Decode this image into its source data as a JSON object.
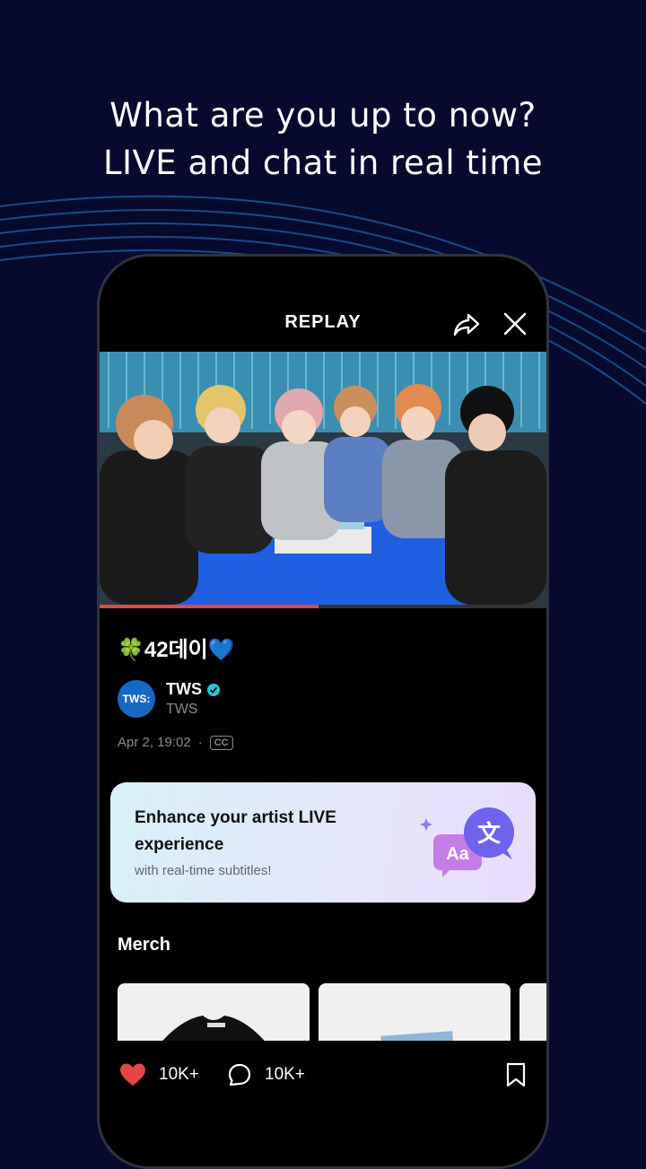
{
  "headline": {
    "line1": "What are you up to now?",
    "line2": "LIVE and chat in real time"
  },
  "player": {
    "mode_label": "REPLAY",
    "progress_fraction": 0.49
  },
  "video": {
    "title": "🍀42데이💙",
    "artist_name": "TWS",
    "artist_handle": "TWS",
    "avatar_text": "TWS:",
    "date": "Apr 2, 19:02",
    "separator": "·",
    "cc_badge": "CC"
  },
  "promo": {
    "title": "Enhance your artist LIVE experience",
    "subtitle": "with real-time subtitles!",
    "icon_text_1": "Aa",
    "icon_text_2": "文"
  },
  "merch": {
    "label": "Merch"
  },
  "actions": {
    "likes": "10K+",
    "comments": "10K+"
  },
  "colors": {
    "background": "#070a2e",
    "accent_red": "#e64545",
    "verified": "#26c6da",
    "avatar": "#1768c2"
  }
}
